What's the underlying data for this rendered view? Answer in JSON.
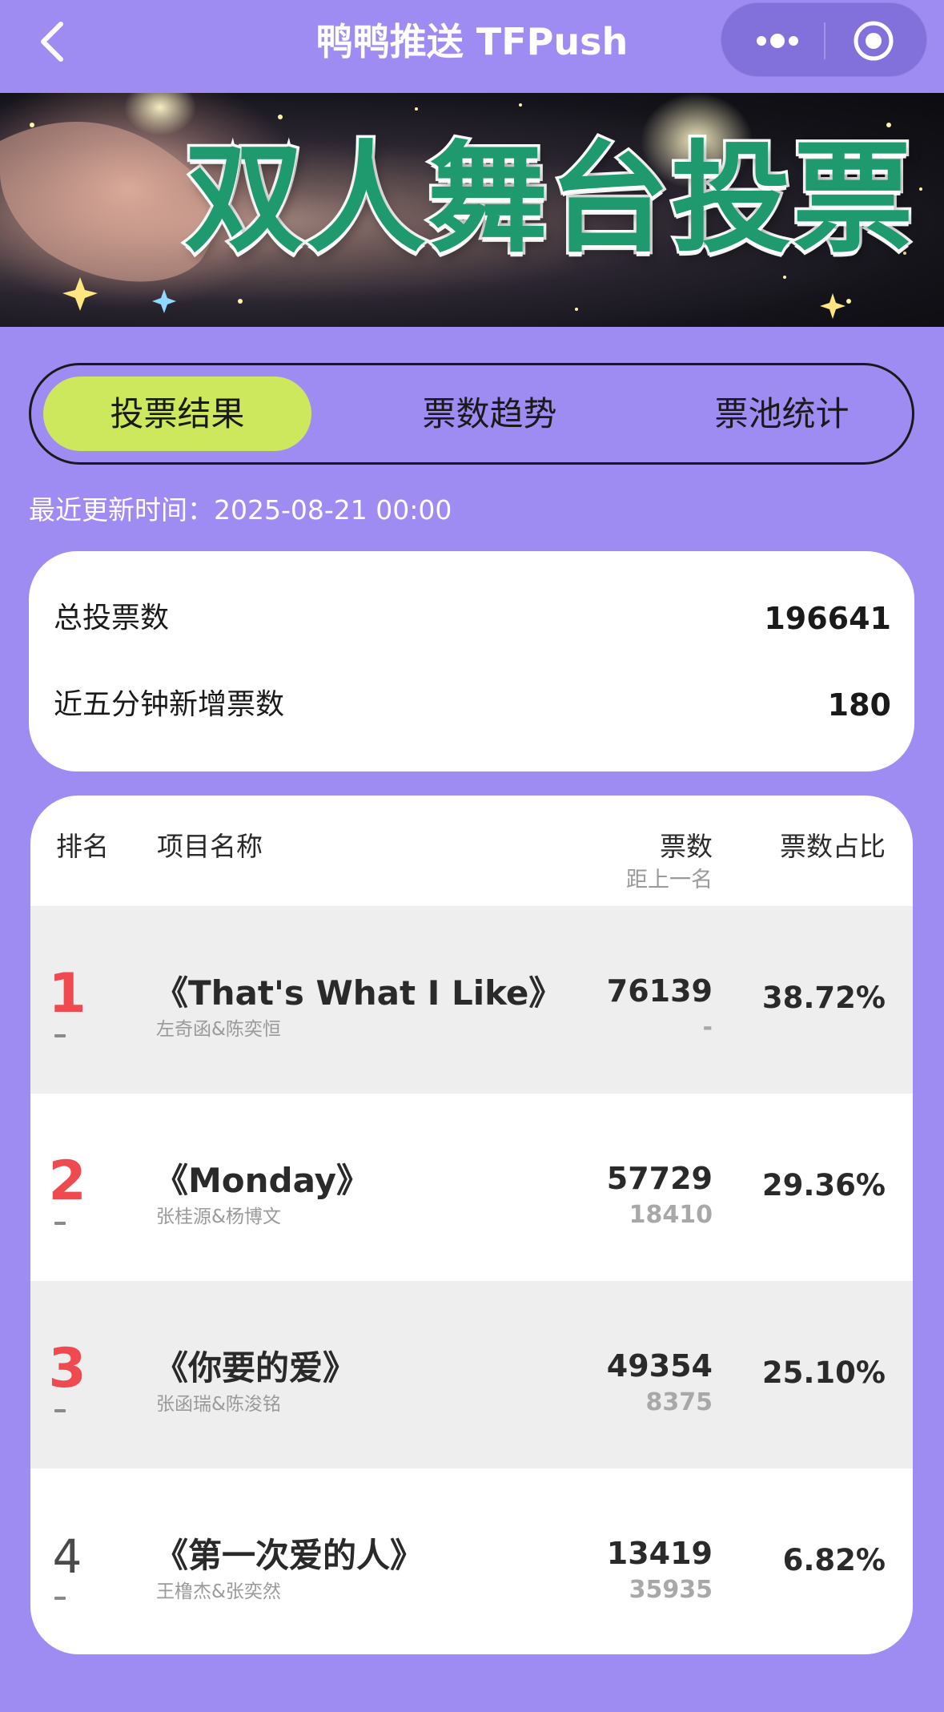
{
  "nav": {
    "title": "鸭鸭推送 TFPush",
    "back_icon": "chevron-left-icon",
    "more_icon": "more-dots-icon",
    "close_icon": "target-close-icon"
  },
  "banner": {
    "title": "双人舞台投票",
    "title_color": "#1f9a6e"
  },
  "tabs": [
    {
      "label": "投票结果",
      "active": true
    },
    {
      "label": "票数趋势",
      "active": false
    },
    {
      "label": "票池统计",
      "active": false
    }
  ],
  "update_time": "最近更新时间：2025-08-21 00:00",
  "summary": {
    "total_label": "总投票数",
    "total_value": "196641",
    "recent_label": "近五分钟新增票数",
    "recent_value": "180"
  },
  "table": {
    "headers": {
      "rank": "排名",
      "name": "项目名称",
      "votes": "票数",
      "votes_sub": "距上一名",
      "share": "票数占比"
    },
    "rows": [
      {
        "rank": "1",
        "title": "《That's What I Like》",
        "artists": "左奇函&陈奕恒",
        "votes": "76139",
        "gap": "-",
        "share": "38.72%"
      },
      {
        "rank": "2",
        "title": "《Monday》",
        "artists": "张桂源&杨博文",
        "votes": "57729",
        "gap": "18410",
        "share": "29.36%"
      },
      {
        "rank": "3",
        "title": "《你要的爱》",
        "artists": "张函瑞&陈浚铭",
        "votes": "49354",
        "gap": "8375",
        "share": "25.10%"
      },
      {
        "rank": "4",
        "title": "《第一次爱的人》",
        "artists": "王橹杰&张奕然",
        "votes": "13419",
        "gap": "35935",
        "share": "6.82%"
      }
    ]
  },
  "colors": {
    "page_bg": "#9f8cf3",
    "active_tab": "#cde85c",
    "rank_top": "#ee4a4f"
  }
}
